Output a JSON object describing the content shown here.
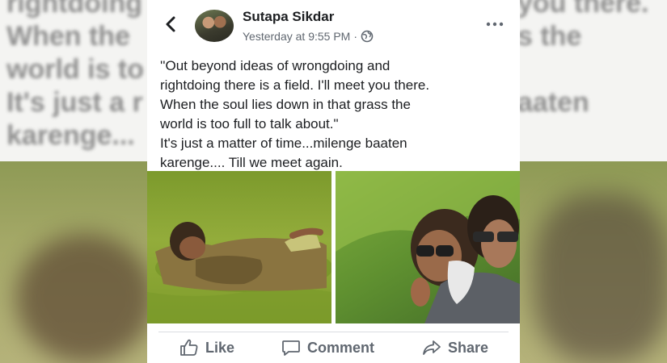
{
  "backdrop": {
    "left_text": "rightdoing\nWhen the\nworld is to\nIt's just a r\nkarenge...",
    "right_text": "you there.\ns the\n\naaten"
  },
  "post": {
    "author": "Sutapa Sikdar",
    "timestamp": "Yesterday at 9:55 PM",
    "separator": "·",
    "privacy_icon": "globe-icon",
    "text_lines": [
      "''Out beyond ideas of wrongdoing and",
      "rightdoing there is a field. I'll meet you there.",
      "When the soul lies down in that grass the",
      "world is too full to talk about.\"",
      "It's just a matter of time...milenge baaten",
      "karenge.... Till we meet again."
    ]
  },
  "actions": {
    "like": "Like",
    "comment": "Comment",
    "share": "Share"
  },
  "colors": {
    "card_bg": "#ffffff",
    "text": "#1c1e21",
    "muted": "#606770",
    "divider": "#dadde1"
  }
}
